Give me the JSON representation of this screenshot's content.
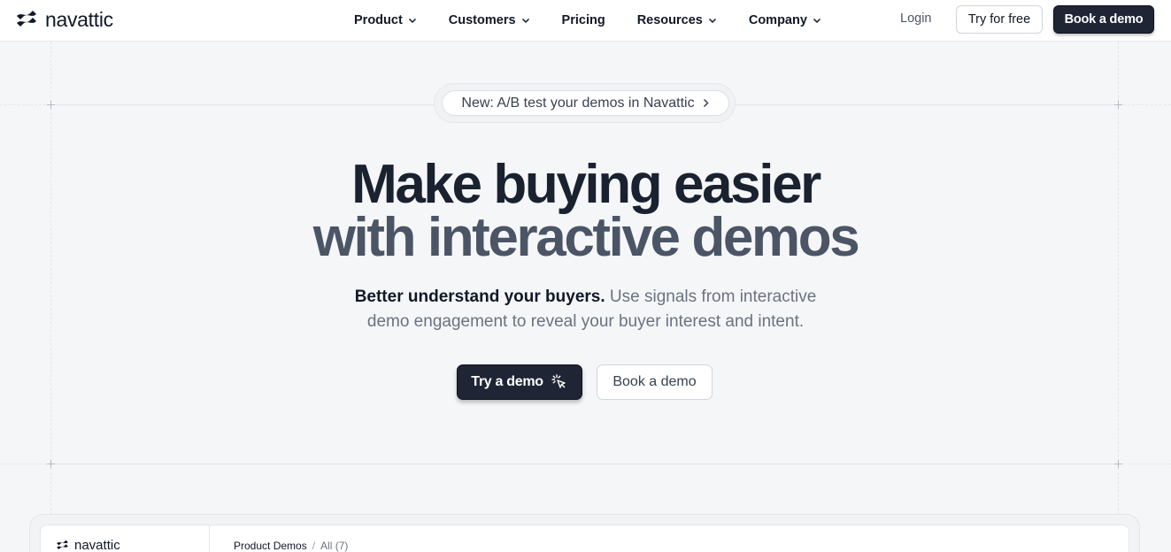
{
  "brand": {
    "name": "navattic"
  },
  "nav": {
    "items": [
      {
        "label": "Product",
        "has_dropdown": true
      },
      {
        "label": "Customers",
        "has_dropdown": true
      },
      {
        "label": "Pricing",
        "has_dropdown": false
      },
      {
        "label": "Resources",
        "has_dropdown": true
      },
      {
        "label": "Company",
        "has_dropdown": true
      }
    ],
    "login": "Login",
    "try_free": "Try for free",
    "book_demo": "Book a demo"
  },
  "announcement": {
    "label": "New: A/B test your demos in Navattic",
    "icon": "chevron-right-icon"
  },
  "hero": {
    "title_line1": "Make buying easier",
    "title_line2": "with interactive demos",
    "subtitle_bold": "Better understand your buyers.",
    "subtitle_rest_1": "Use signals from interactive",
    "subtitle_rest_2": "demo engagement to reveal your buyer interest and intent.",
    "cta_primary": "Try a demo",
    "cta_primary_icon": "cursor-click-icon",
    "cta_secondary": "Book a demo"
  },
  "preview": {
    "brand": "navattic",
    "breadcrumb": {
      "section": "Product Demos",
      "separator": "/",
      "current": "All (7)"
    }
  },
  "colors": {
    "background": "#f5f6f8",
    "primary_button": "#1f2535",
    "heading_dark": "#1a2230",
    "heading_muted": "#4b5565"
  }
}
